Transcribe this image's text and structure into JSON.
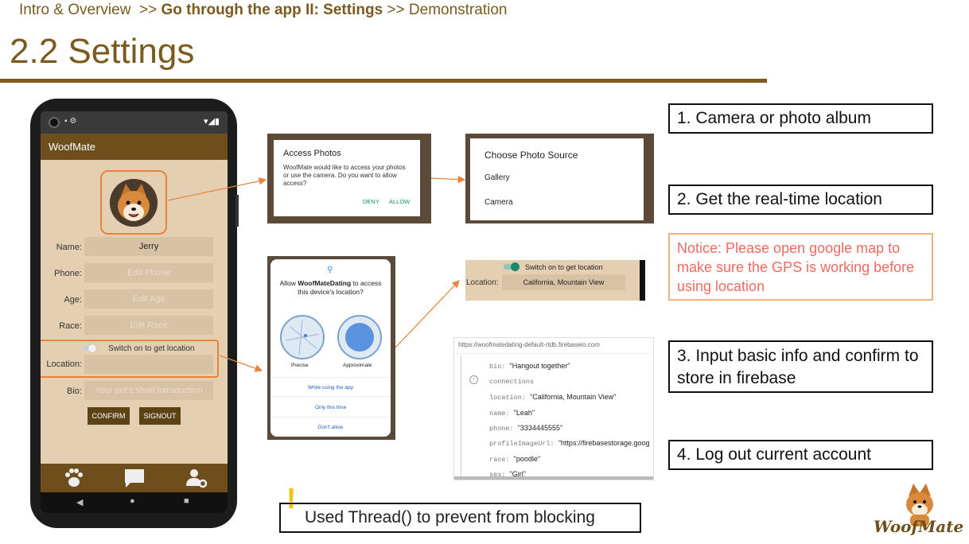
{
  "breadcrumb": {
    "part1": "Intro & Overview",
    "sep1": ">>",
    "part2": "Go through the app II: Settings",
    "sep2": ">>",
    "part3": "Demonstration"
  },
  "slide_title": "2.2 Settings",
  "phone": {
    "app_title": "WoofMate",
    "fields": [
      {
        "label": "Name:",
        "value": "Jerry"
      },
      {
        "label": "Phone:",
        "placeholder": "Edit Phone"
      },
      {
        "label": "Age:",
        "placeholder": "Edit Age"
      },
      {
        "label": "Race:",
        "placeholder": "Edit Race"
      },
      {
        "label": "Location:",
        "placeholder": ""
      },
      {
        "label": "Bio:",
        "placeholder": "Your pet's short introduction"
      }
    ],
    "toggle_label": "Switch on to get location",
    "confirm": "CONFIRM",
    "signout": "SIGNOUT"
  },
  "dialog_access": {
    "title": "Access Photos",
    "body": "WoofMate would like to access your photos or use the camera. Do you want to allow access?",
    "deny": "DENY",
    "allow": "ALLOW"
  },
  "dialog_source": {
    "title": "Choose Photo Source",
    "options": [
      "Gallery",
      "Camera"
    ]
  },
  "dialog_location": {
    "prefix": "Allow ",
    "app": "WoofMateDating",
    "suffix": " to access this device's location?",
    "precise": "Precise",
    "approximate": "Approximate",
    "options": [
      "While using the app",
      "Only this time",
      "Don't allow"
    ]
  },
  "location_snippet": {
    "toggle_label": "Switch on to get location",
    "label": "Location:",
    "value": "California, Mountain View"
  },
  "firebase": {
    "url": "https://woofmatedating-default-rtdb.firebaseio.com",
    "rows": [
      {
        "key": "bio:",
        "value": "\"Hangout together\""
      },
      {
        "key": "connections",
        "value": ""
      },
      {
        "key": "location:",
        "value": "\"California, Mountain View\""
      },
      {
        "key": "name:",
        "value": "\"Leah\""
      },
      {
        "key": "phone:",
        "value": "\"3334445555\""
      },
      {
        "key": "profileImageUrl:",
        "value": "\"https://firebasestorage.goog"
      },
      {
        "key": "race:",
        "value": "\"poodle\""
      },
      {
        "key": "sex:",
        "value": "\"Girl\""
      }
    ]
  },
  "callouts": {
    "c1": "1. Camera or photo album",
    "c2": "2. Get the real-time location",
    "notice": "Notice: Please open google map to make sure the GPS is working before using location",
    "c3": "3. Input basic info and confirm to store in firebase",
    "c4": "4. Log out current account",
    "thread": "Used Thread() to prevent from blocking"
  },
  "logo": "WoofMate",
  "colors": {
    "brand": "#6e4f1c",
    "highlight": "#e8833a",
    "notice": "#f06a60",
    "warning": "#f2c200"
  }
}
